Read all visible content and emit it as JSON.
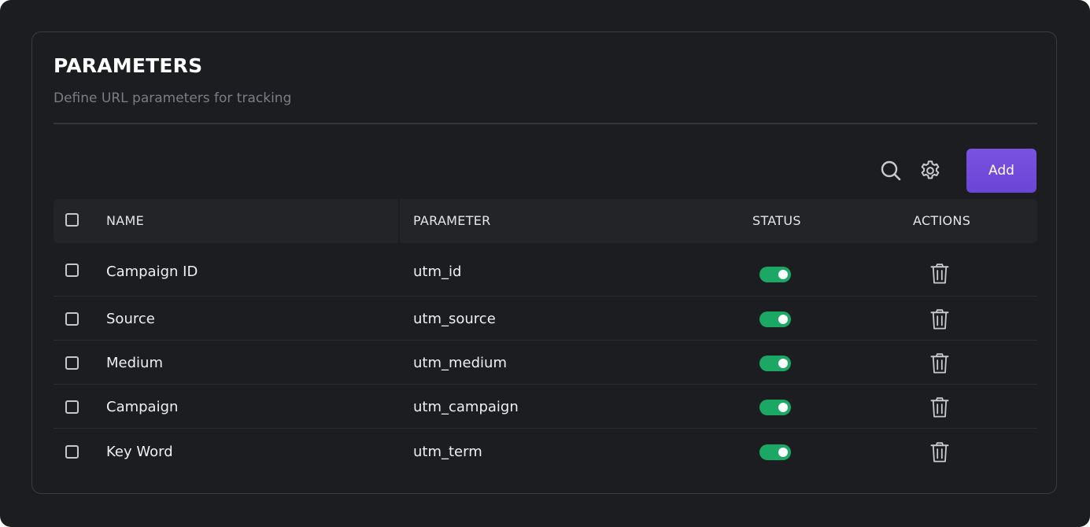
{
  "header": {
    "title": "PARAMETERS",
    "subtitle": "Define URL parameters for tracking"
  },
  "toolbar": {
    "search_icon": "search-icon",
    "settings_icon": "gear-icon",
    "add_label": "Add"
  },
  "table": {
    "columns": {
      "name": "NAME",
      "parameter": "PARAMETER",
      "status": "STATUS",
      "actions": "ACTIONS"
    },
    "rows": [
      {
        "name": "Campaign ID",
        "parameter": "utm_id",
        "status": "on"
      },
      {
        "name": "Source",
        "parameter": "utm_source",
        "status": "on"
      },
      {
        "name": "Medium",
        "parameter": "utm_medium",
        "status": "on"
      },
      {
        "name": "Campaign",
        "parameter": "utm_campaign",
        "status": "on"
      },
      {
        "name": "Key Word",
        "parameter": "utm_term",
        "status": "on"
      }
    ]
  },
  "colors": {
    "background": "#1c1d21",
    "accent": "#6f4ad9",
    "status_on": "#1aa864",
    "text": "#ffffff",
    "muted_text": "#7a7d85"
  }
}
